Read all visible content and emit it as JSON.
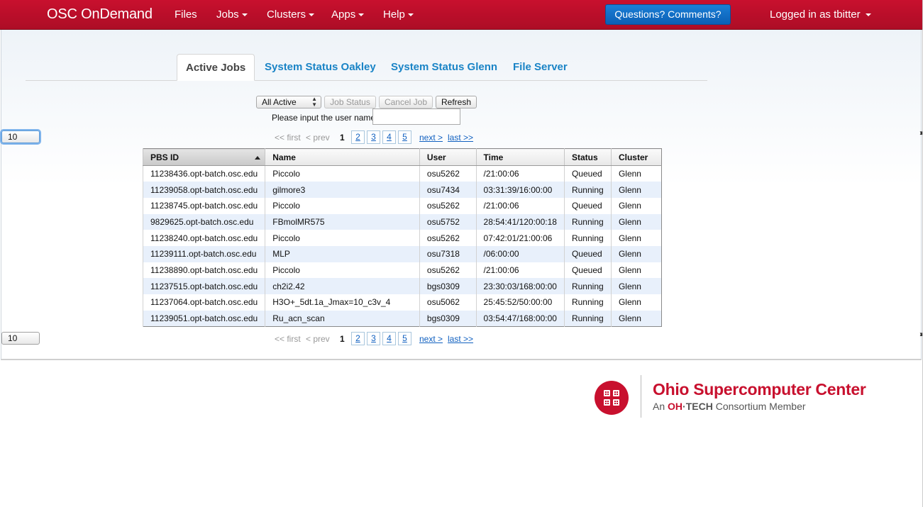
{
  "navbar": {
    "brand": "OSC OnDemand",
    "items": [
      {
        "label": "Files",
        "dropdown": false
      },
      {
        "label": "Jobs",
        "dropdown": true
      },
      {
        "label": "Clusters",
        "dropdown": true
      },
      {
        "label": "Apps",
        "dropdown": true
      },
      {
        "label": "Help",
        "dropdown": true
      }
    ],
    "questions_button": "Questions? Comments?",
    "logged_in": "Logged in as tbitter",
    "colors": {
      "bar": "#c8102e",
      "button": "#0b63c5"
    }
  },
  "tabs": [
    {
      "label": "Active Jobs",
      "active": true
    },
    {
      "label": "System Status Oakley",
      "active": false
    },
    {
      "label": "System Status Glenn",
      "active": false
    },
    {
      "label": "File Server",
      "active": false
    }
  ],
  "controls": {
    "filter_select": "All Active",
    "job_status_button": "Job Status",
    "cancel_job_button": "Cancel Job",
    "refresh_button": "Refresh",
    "user_label": "Please input the user name:",
    "user_input_value": ""
  },
  "pager": {
    "first": "<< first",
    "prev": "< prev",
    "current": "1",
    "pages": [
      "2",
      "3",
      "4",
      "5"
    ],
    "next": "next >",
    "last": "last >>",
    "page_size": "10"
  },
  "table": {
    "columns": [
      "PBS ID",
      "Name",
      "User",
      "Time",
      "Status",
      "Cluster"
    ],
    "sorted_column": "PBS ID",
    "rows": [
      [
        "11238436.opt-batch.osc.edu",
        "Piccolo",
        "osu5262",
        "/21:00:06",
        "Queued",
        "Glenn"
      ],
      [
        "11239058.opt-batch.osc.edu",
        "gilmore3",
        "osu7434",
        "03:31:39/16:00:00",
        "Running",
        "Glenn"
      ],
      [
        "11238745.opt-batch.osc.edu",
        "Piccolo",
        "osu5262",
        "/21:00:06",
        "Queued",
        "Glenn"
      ],
      [
        "9829625.opt-batch.osc.edu",
        "FBmolMR575",
        "osu5752",
        "28:54:41/120:00:18",
        "Running",
        "Glenn"
      ],
      [
        "11238240.opt-batch.osc.edu",
        "Piccolo",
        "osu5262",
        "07:42:01/21:00:06",
        "Running",
        "Glenn"
      ],
      [
        "11239111.opt-batch.osc.edu",
        "MLP",
        "osu7318",
        "/06:00:00",
        "Queued",
        "Glenn"
      ],
      [
        "11238890.opt-batch.osc.edu",
        "Piccolo",
        "osu5262",
        "/21:00:06",
        "Queued",
        "Glenn"
      ],
      [
        "11237515.opt-batch.osc.edu",
        "ch2i2.42",
        "bgs0309",
        "23:30:03/168:00:00",
        "Running",
        "Glenn"
      ],
      [
        "11237064.opt-batch.osc.edu",
        "H3O+_5dt.1a_Jmax=10_c3v_4",
        "osu5062",
        "25:45:52/50:00:00",
        "Running",
        "Glenn"
      ],
      [
        "11239051.opt-batch.osc.edu",
        "Ru_acn_scan",
        "bgs0309",
        "03:54:47/168:00:00",
        "Running",
        "Glenn"
      ]
    ]
  },
  "footer": {
    "org_name": "Ohio Supercomputer Center",
    "sub_prefix": "An ",
    "sub_oh": "OH",
    "sub_dot": "·",
    "sub_tech": "TECH",
    "sub_suffix": " Consortium Member",
    "logo_icon": "osc-logo-icon",
    "brand_color": "#c8102e"
  }
}
